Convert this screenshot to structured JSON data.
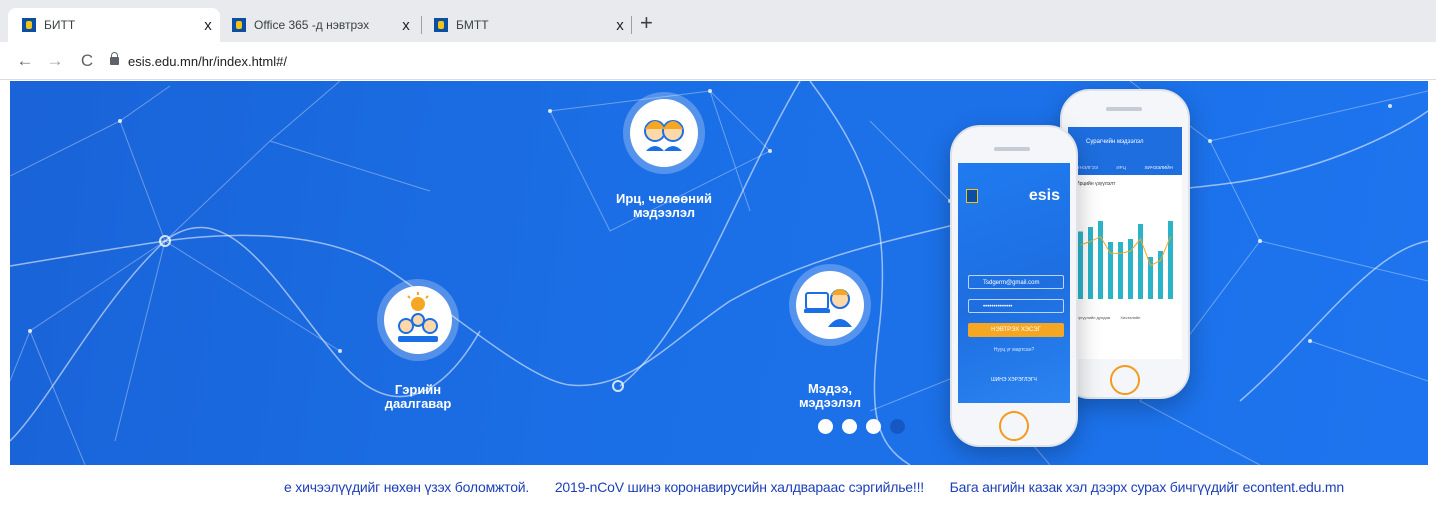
{
  "browser": {
    "tabs": [
      {
        "title": "БИТТ",
        "close": "x",
        "active": true
      },
      {
        "title": "Office 365 -д нэвтрэх",
        "close": "x",
        "active": false
      },
      {
        "title": "БМТТ",
        "close": "x",
        "active": false
      }
    ],
    "new_tab": "+",
    "nav": {
      "back": "←",
      "forward": "→",
      "reload": "C"
    },
    "url": "esis.edu.mn/hr/index.html#/"
  },
  "hero": {
    "features": [
      {
        "label": "Ирц, чөлөөний\nмэдээлэл",
        "icon": "students-icon"
      },
      {
        "label": "Гэрийн\nдаалгавар",
        "icon": "homework-icon"
      },
      {
        "label": "Мэдээ,\nмэдээлэл",
        "icon": "news-icon"
      }
    ],
    "carousel": {
      "count": 4,
      "active_index": 3
    },
    "login_phone": {
      "brand": "esis",
      "email": "Tsdgerm@gmail.com",
      "password": "••••••••••••••",
      "login_button": "НЭВТРЭХ ХЭСЭГ",
      "forgot": "Нууц үг мартсан?",
      "footer": "ШИНЭ ХЭРЭГЛЭГЧ"
    },
    "attendance_phone": {
      "title": "Сурагчийн мэдээлэл",
      "tabs": [
        "ҮНЭЛГЭЭ",
        "ИРЦ",
        "ХИЧЭЭЛИЙН"
      ],
      "chart_title": "Ирцийн үзүүлэлт",
      "legend": [
        "Сургуулийн дундаж",
        "Хичээлийн"
      ],
      "bar_values": [
        45,
        48,
        52,
        38,
        38,
        40,
        50,
        28,
        32,
        52
      ]
    }
  },
  "ticker": {
    "items": [
      "е хичээлүүдийг нөхөн үзэх боломжтой.",
      "2019-nCoV шинэ коронавирусийн халдвараас сэргийлье!!!",
      "Бага ангийн казак хэл дээрх сурах бичгүүдийг econtent.edu.mn"
    ]
  },
  "colors": {
    "banner": "#1b6fe6",
    "accent_orange": "#f5a623",
    "ticker_text": "#1d3fb8"
  }
}
